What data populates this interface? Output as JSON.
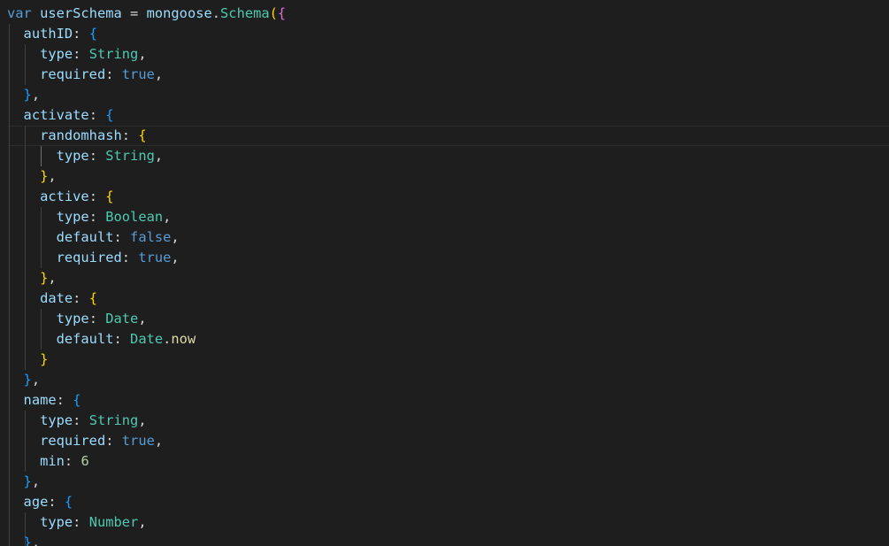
{
  "editor": {
    "language": "javascript",
    "theme": "dark",
    "colors": {
      "background": "#1e1e1e",
      "keyword": "#569cd6",
      "variable": "#9cdcfe",
      "type": "#4ec9b0",
      "number": "#b5cea8",
      "function": "#dcdcaa",
      "bracket_gold": "#ffd700",
      "bracket_orchid": "#da70d6",
      "bracket_blue": "#179fff"
    },
    "lines": [
      {
        "text": "var userSchema = mongoose.Schema({"
      },
      {
        "text": "  authID: {"
      },
      {
        "text": "    type: String,"
      },
      {
        "text": "    required: true,"
      },
      {
        "text": "  },"
      },
      {
        "text": "  activate: {"
      },
      {
        "text": "    randomhash: {"
      },
      {
        "text": "      type: String,"
      },
      {
        "text": "    },"
      },
      {
        "text": "    active: {"
      },
      {
        "text": "      type: Boolean,"
      },
      {
        "text": "      default: false,"
      },
      {
        "text": "      required: true,"
      },
      {
        "text": "    },"
      },
      {
        "text": "    date: {"
      },
      {
        "text": "      type: Date,"
      },
      {
        "text": "      default: Date.now"
      },
      {
        "text": "    }"
      },
      {
        "text": "  },"
      },
      {
        "text": "  name: {"
      },
      {
        "text": "    type: String,"
      },
      {
        "text": "    required: true,"
      },
      {
        "text": "    min: 6"
      },
      {
        "text": "  },"
      },
      {
        "text": "  age: {"
      },
      {
        "text": "    type: Number,"
      },
      {
        "text": "  },"
      }
    ]
  }
}
